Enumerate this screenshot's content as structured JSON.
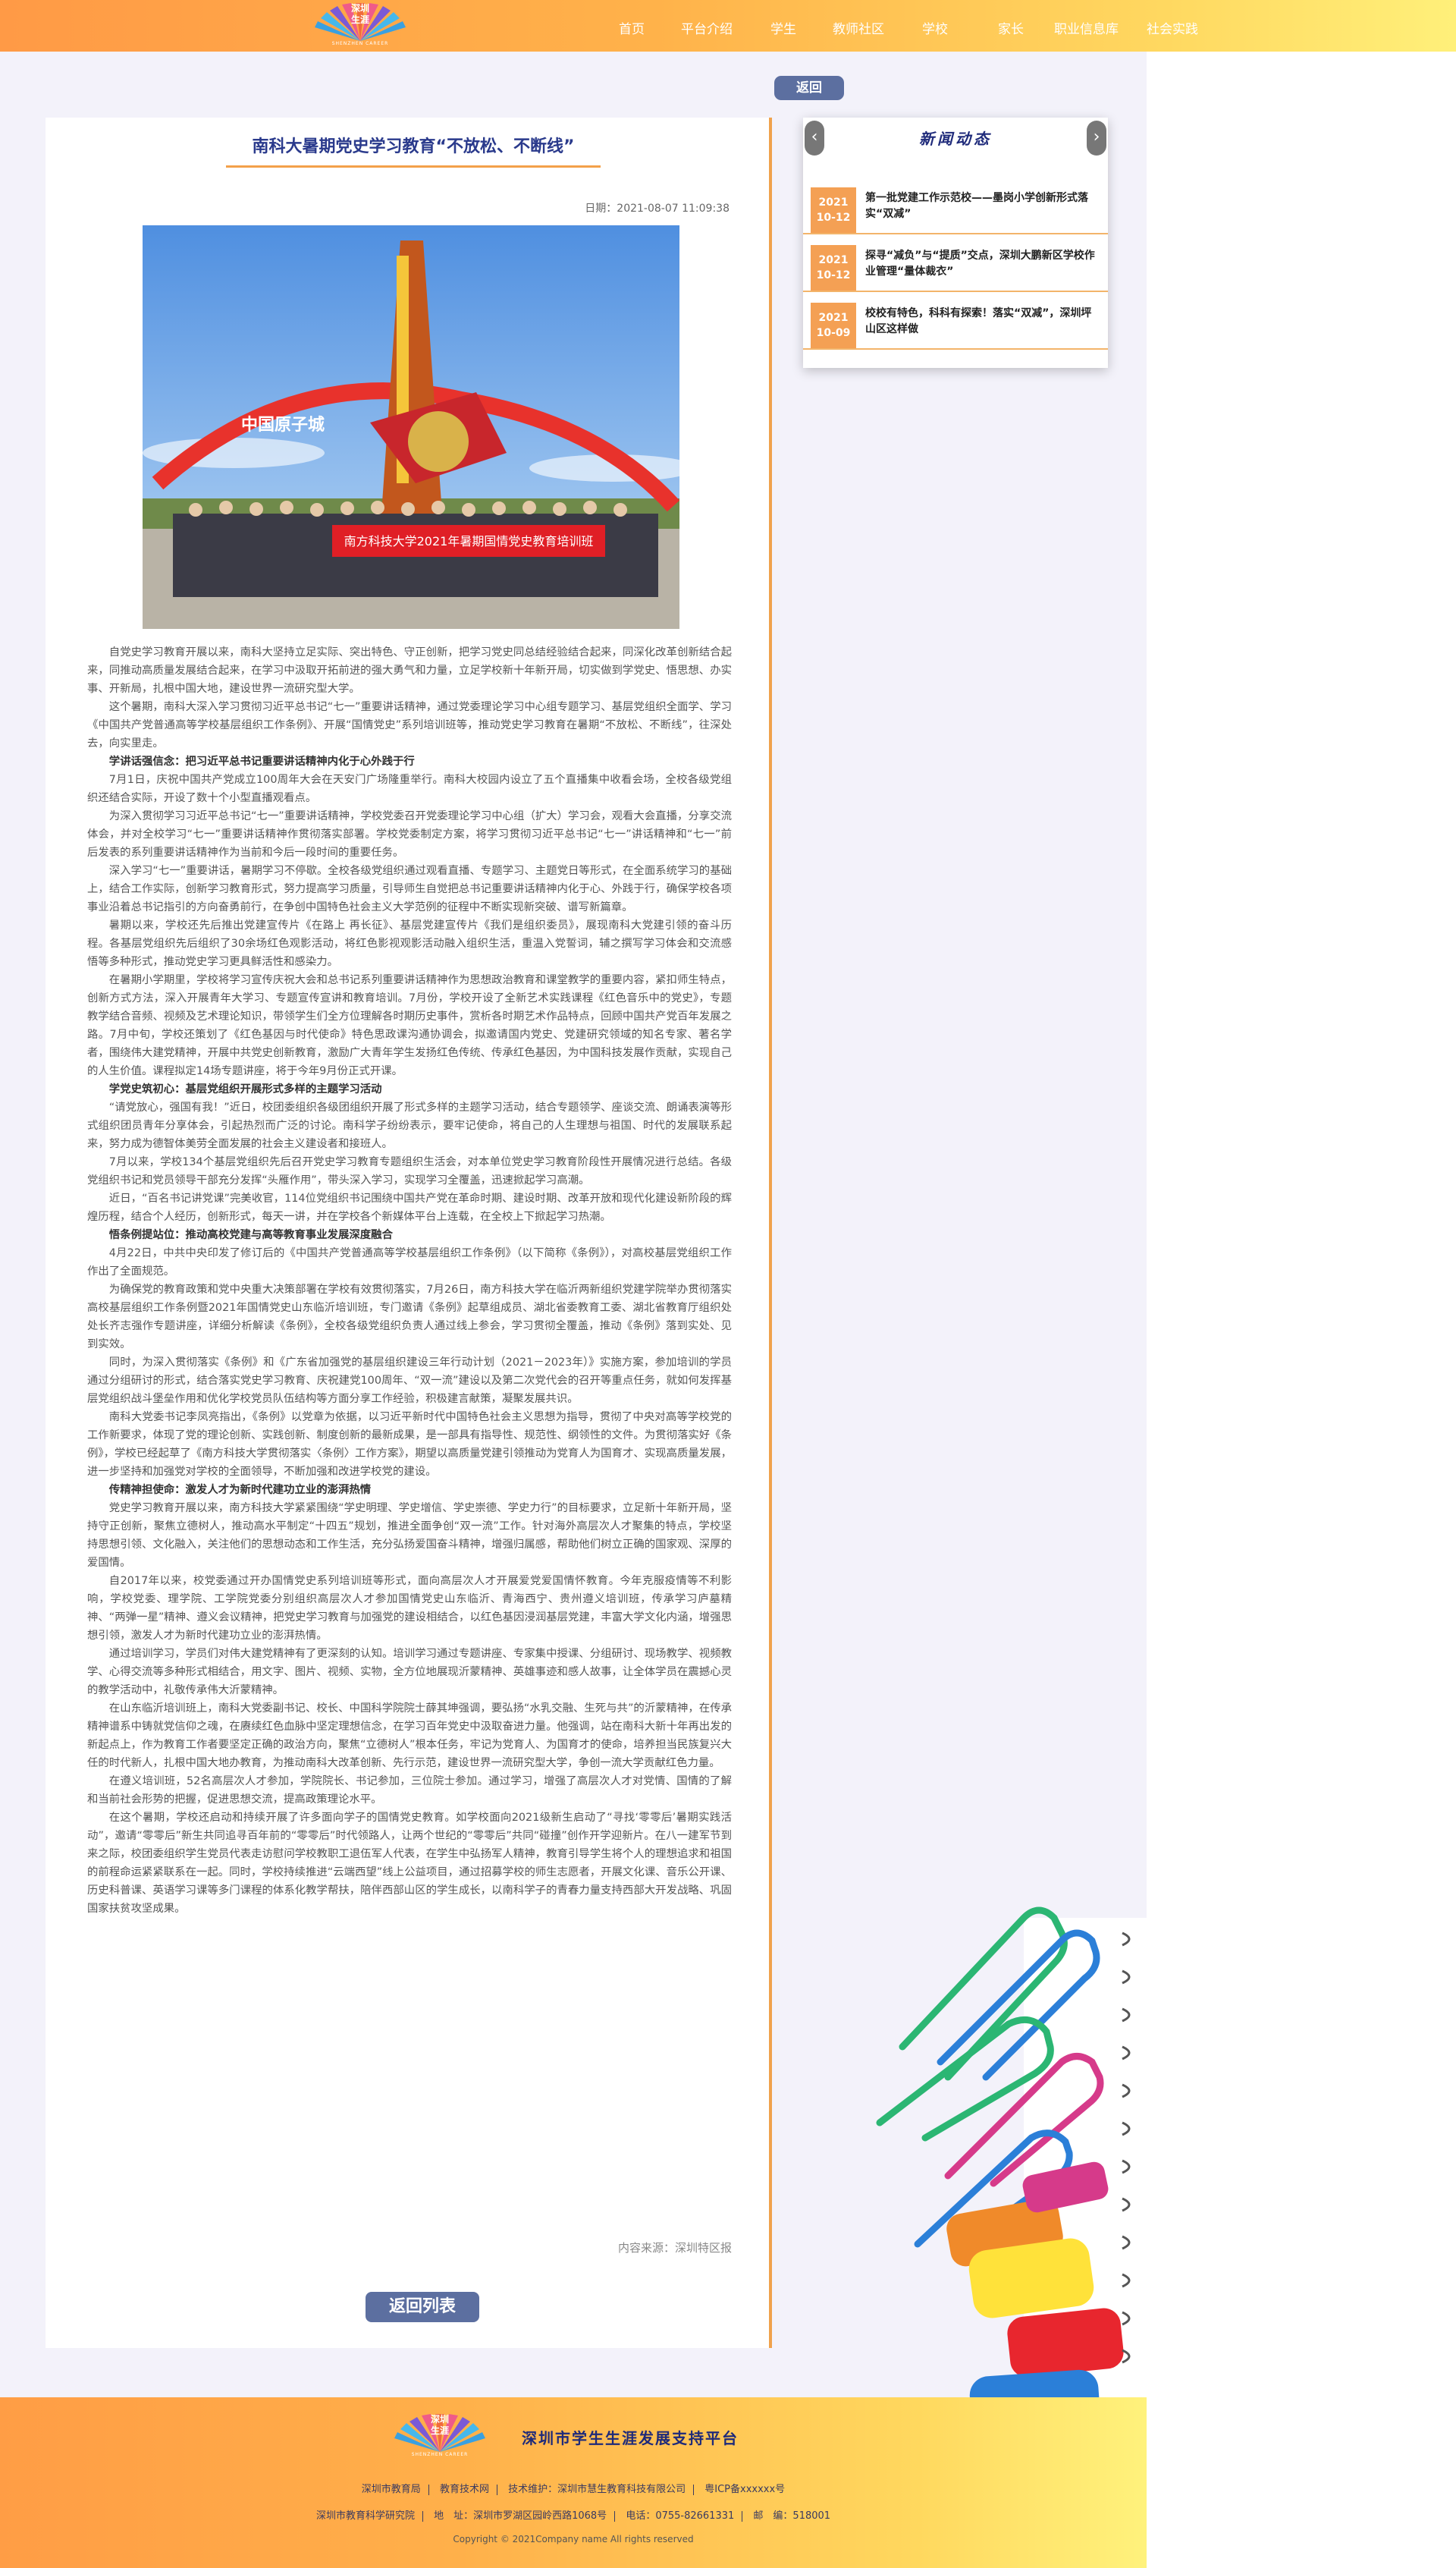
{
  "header": {
    "logo_name": "深圳\n生涯",
    "logo_sub": "SHENZHEN CAREER",
    "nav": [
      "首页",
      "平台介绍",
      "学生",
      "教师社区",
      "学校",
      "家长",
      "职业信息库",
      "社会实践"
    ]
  },
  "back_button": "返回",
  "article": {
    "title": "南科大暑期党史学习教育“不放松、不断线”",
    "date": "日期：2021-08-07 11:09:38",
    "photo_banner": "南方科技大学2021年暑期国情党史教育培训班",
    "photo_sign": "中国原子城",
    "paragraphs": [
      {
        "type": "p",
        "text": "自党史学习教育开展以来，南科大坚持立足实际、突出特色、守正创新，把学习党史同总结经验结合起来，同深化改革创新结合起来，同推动高质量发展结合起来，在学习中汲取开拓前进的强大勇气和力量，立足学校新十年新开局，切实做到学党史、悟思想、办实事、开新局，扎根中国大地，建设世界一流研究型大学。"
      },
      {
        "type": "p",
        "text": "这个暑期，南科大深入学习贯彻习近平总书记“七一”重要讲话精神，通过党委理论学习中心组专题学习、基层党组织全面学、学习《中国共产党普通高等学校基层组织工作条例》、开展“国情党史”系列培训班等，推动党史学习教育在暑期“不放松、不断线”，往深处去，向实里走。"
      },
      {
        "type": "h",
        "text": "学讲话强信念：把习近平总书记重要讲话精神内化于心外践于行"
      },
      {
        "type": "p",
        "text": "7月1日，庆祝中国共产党成立100周年大会在天安门广场隆重举行。南科大校园内设立了五个直播集中收看会场，全校各级党组织还结合实际，开设了数十个小型直播观看点。"
      },
      {
        "type": "p",
        "text": "为深入贯彻学习习近平总书记“七一”重要讲话精神，学校党委召开党委理论学习中心组（扩大）学习会，观看大会直播，分享交流体会，并对全校学习“七一”重要讲话精神作贯彻落实部署。学校党委制定方案，将学习贯彻习近平总书记“七一”讲话精神和“七一”前后发表的系列重要讲话精神作为当前和今后一段时间的重要任务。"
      },
      {
        "type": "p",
        "text": "深入学习“七一”重要讲话，暑期学习不停歇。全校各级党组织通过观看直播、专题学习、主题党日等形式，在全面系统学习的基础上，结合工作实际，创新学习教育形式，努力提高学习质量，引导师生自觉把总书记重要讲话精神内化于心、外践于行，确保学校各项事业沿着总书记指引的方向奋勇前行，在争创中国特色社会主义大学范例的征程中不断实现新突破、谱写新篇章。"
      },
      {
        "type": "p",
        "text": "暑期以来，学校还先后推出党建宣传片《在路上 再长征》、基层党建宣传片《我们是组织委员》，展现南科大党建引领的奋斗历程。各基层党组织先后组织了30余场红色观影活动，将红色影视观影活动融入组织生活，重温入党誓词，辅之撰写学习体会和交流感悟等多种形式，推动党史学习更具鲜活性和感染力。"
      },
      {
        "type": "p",
        "text": "在暑期小学期里，学校将学习宣传庆祝大会和总书记系列重要讲话精神作为思想政治教育和课堂教学的重要内容，紧扣师生特点，创新方式方法，深入开展青年大学习、专题宣传宣讲和教育培训。7月份，学校开设了全新艺术实践课程《红色音乐中的党史》，专题教学结合音频、视频及艺术理论知识，带领学生们全方位理解各时期历史事件，赏析各时期艺术作品特点，回顾中国共产党百年发展之路。7月中旬，学校还策划了《红色基因与时代使命》特色思政课沟通协调会，拟邀请国内党史、党建研究领域的知名专家、著名学者，围绕伟大建党精神，开展中共党史创新教育，激励广大青年学生发扬红色传统、传承红色基因，为中国科技发展作贡献，实现自己的人生价值。课程拟定14场专题讲座，将于今年9月份正式开课。"
      },
      {
        "type": "h",
        "text": "学党史筑初心：基层党组织开展形式多样的主题学习活动"
      },
      {
        "type": "p",
        "text": "“请党放心，强国有我！”近日，校团委组织各级团组织开展了形式多样的主题学习活动，结合专题领学、座谈交流、朗诵表演等形式组织团员青年分享体会，引起热烈而广泛的讨论。南科学子纷纷表示，要牢记使命，将自己的人生理想与祖国、时代的发展联系起来，努力成为德智体美劳全面发展的社会主义建设者和接班人。"
      },
      {
        "type": "p",
        "text": "7月以来，学校134个基层党组织先后召开党史学习教育专题组织生活会，对本单位党史学习教育阶段性开展情况进行总结。各级党组织书记和党员领导干部充分发挥“头雁作用”，带头深入学习，实现学习全覆盖，迅速掀起学习高潮。"
      },
      {
        "type": "p",
        "text": "近日，“百名书记讲党课”完美收官，114位党组织书记围绕中国共产党在革命时期、建设时期、改革开放和现代化建设新阶段的辉煌历程，结合个人经历，创新形式，每天一讲，并在学校各个新媒体平台上连载，在全校上下掀起学习热潮。"
      },
      {
        "type": "h",
        "text": "悟条例提站位：推动高校党建与高等教育事业发展深度融合"
      },
      {
        "type": "p",
        "text": "4月22日，中共中央印发了修订后的《中国共产党普通高等学校基层组织工作条例》（以下简称《条例》），对高校基层党组织工作作出了全面规范。"
      },
      {
        "type": "p",
        "text": "为确保党的教育政策和党中央重大决策部署在学校有效贯彻落实，7月26日，南方科技大学在临沂两新组织党建学院举办贯彻落实高校基层组织工作条例暨2021年国情党史山东临沂培训班，专门邀请《条例》起草组成员、湖北省委教育工委、湖北省教育厅组织处处长齐志强作专题讲座，详细分析解读《条例》，全校各级党组织负责人通过线上参会，学习贯彻全覆盖，推动《条例》落到实处、见到实效。"
      },
      {
        "type": "p",
        "text": "同时，为深入贯彻落实《条例》和《广东省加强党的基层组织建设三年行动计划（2021－2023年）》实施方案，参加培训的学员通过分组研讨的形式，结合落实党史学习教育、庆祝建党100周年、“双一流”建设以及第二次党代会的召开等重点任务，就如何发挥基层党组织战斗堡垒作用和优化学校党员队伍结构等方面分享工作经验，积极建言献策，凝聚发展共识。"
      },
      {
        "type": "p",
        "text": "南科大党委书记李凤亮指出，《条例》以党章为依据，以习近平新时代中国特色社会主义思想为指导，贯彻了中央对高等学校党的工作新要求，体现了党的理论创新、实践创新、制度创新的最新成果，是一部具有指导性、规范性、纲领性的文件。为贯彻落实好《条例》，学校已经起草了《南方科技大学贯彻落实〈条例〉工作方案》，期望以高质量党建引领推动为党育人为国育才、实现高质量发展，进一步坚持和加强党对学校的全面领导，不断加强和改进学校党的建设。"
      },
      {
        "type": "h",
        "text": "传精神担使命：激发人才为新时代建功立业的澎湃热情"
      },
      {
        "type": "p",
        "text": "党史学习教育开展以来，南方科技大学紧紧围绕“学史明理、学史增信、学史崇德、学史力行”的目标要求，立足新十年新开局，坚持守正创新，聚焦立德树人，推动高水平制定“十四五”规划，推进全面争创“双一流”工作。针对海外高层次人才聚集的特点，学校坚持思想引领、文化融入，关注他们的思想动态和工作生活，充分弘扬爱国奋斗精神，增强归属感，帮助他们树立正确的国家观、深厚的爱国情。"
      },
      {
        "type": "p",
        "text": "自2017年以来，校党委通过开办国情党史系列培训班等形式，面向高层次人才开展爱党爱国情怀教育。今年克服疫情等不利影响，学校党委、理学院、工学院党委分别组织高层次人才参加国情党史山东临沂、青海西宁、贵州遵义培训班，传承学习庐墓精神、“两弹一星”精神、遵义会议精神，把党史学习教育与加强党的建设相结合，以红色基因浸润基层党建，丰富大学文化内涵，增强思想引领，激发人才为新时代建功立业的澎湃热情。"
      },
      {
        "type": "p",
        "text": "通过培训学习，学员们对伟大建党精神有了更深刻的认知。培训学习通过专题讲座、专家集中授课、分组研讨、现场教学、视频教学、心得交流等多种形式相结合，用文字、图片、视频、实物，全方位地展现沂蒙精神、英雄事迹和感人故事，让全体学员在震撼心灵的教学活动中，礼敬传承伟大沂蒙精神。"
      },
      {
        "type": "p",
        "text": "在山东临沂培训班上，南科大党委副书记、校长、中国科学院院士薛其坤强调，要弘扬“水乳交融、生死与共”的沂蒙精神，在传承精神谱系中铸就党信仰之魂，在赓续红色血脉中坚定理想信念，在学习百年党史中汲取奋进力量。他强调，站在南科大新十年再出发的新起点上，作为教育工作者要坚定正确的政治方向，聚焦“立德树人”根本任务，牢记为党育人、为国育才的使命，培养担当民族复兴大任的时代新人，扎根中国大地办教育，为推动南科大改革创新、先行示范，建设世界一流研究型大学，争创一流大学贡献红色力量。"
      },
      {
        "type": "p",
        "text": "在遵义培训班，52名高层次人才参加，学院院长、书记参加，三位院士参加。通过学习，增强了高层次人才对党情、国情的了解和当前社会形势的把握，促进思想交流，提高政策理论水平。"
      },
      {
        "type": "p",
        "text": "在这个暑期，学校还启动和持续开展了许多面向学子的国情党史教育。如学校面向2021级新生启动了“寻找‘零零后’暑期实践活动”，邀请“零零后”新生共同追寻百年前的“零零后”时代领路人，让两个世纪的“零零后”共同“碰撞”创作开学迎新片。在八一建军节到来之际，校团委组织学生党员代表走访慰问学校教职工退伍军人代表，在学生中弘扬军人精神，教育引导学生将个人的理想追求和祖国的前程命运紧紧联系在一起。同时，学校持续推进“云端西望”线上公益项目，通过招募学校的师生志愿者，开展文化课、音乐公开课、历史科普课、英语学习课等多门课程的体系化教学帮扶，陪伴西部山区的学生成长，以南科学子的青春力量支持西部大开发战略、巩固国家扶贫攻坚成果。"
      }
    ],
    "source": "内容来源：深圳特区报",
    "back_list": "返回列表"
  },
  "news": {
    "heading": "新闻动态",
    "prev": "‹",
    "next": "›",
    "items": [
      {
        "year": "2021",
        "date": "10-12",
        "title": "第一批党建工作示范校——墨岗小学创新形式落实“双减”"
      },
      {
        "year": "2021",
        "date": "10-12",
        "title": "探寻“减负”与“提质”交点，深圳大鹏新区学校作业管理“量体裁衣”"
      },
      {
        "year": "2021",
        "date": "10-09",
        "title": "校校有特色，科科有探索！落实“双减”，深圳坪山区这样做"
      }
    ]
  },
  "footer": {
    "title": "深圳市学生生涯发展支持平台",
    "links_row1": [
      "深圳市教育局",
      "教育技术网",
      "技术维护：深圳市慧生教育科技有限公司",
      "粤ICP备xxxxxx号"
    ],
    "links_row2": [
      "深圳市教育科学研究院",
      "地　址：深圳市罗湖区园岭西路1068号",
      "电话：0755-82661331",
      "邮　编：518001"
    ],
    "copyright": "Copyright © 2021Company name All rights reserved"
  }
}
